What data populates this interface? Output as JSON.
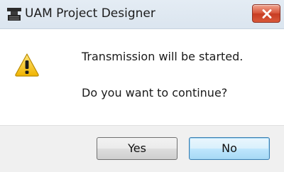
{
  "window": {
    "title": "UAM Project Designer",
    "app_icon": "uam-app-icon",
    "close_icon": "close-icon"
  },
  "message": {
    "icon": "warning-icon",
    "line1": "Transmission will be started.",
    "line2": "Do you want to continue?"
  },
  "buttons": {
    "yes_label": "Yes",
    "no_label": "No"
  },
  "colors": {
    "close_button": "#d8553a",
    "warning_yellow": "#f5c400",
    "default_button_border": "#3c7fb1"
  }
}
